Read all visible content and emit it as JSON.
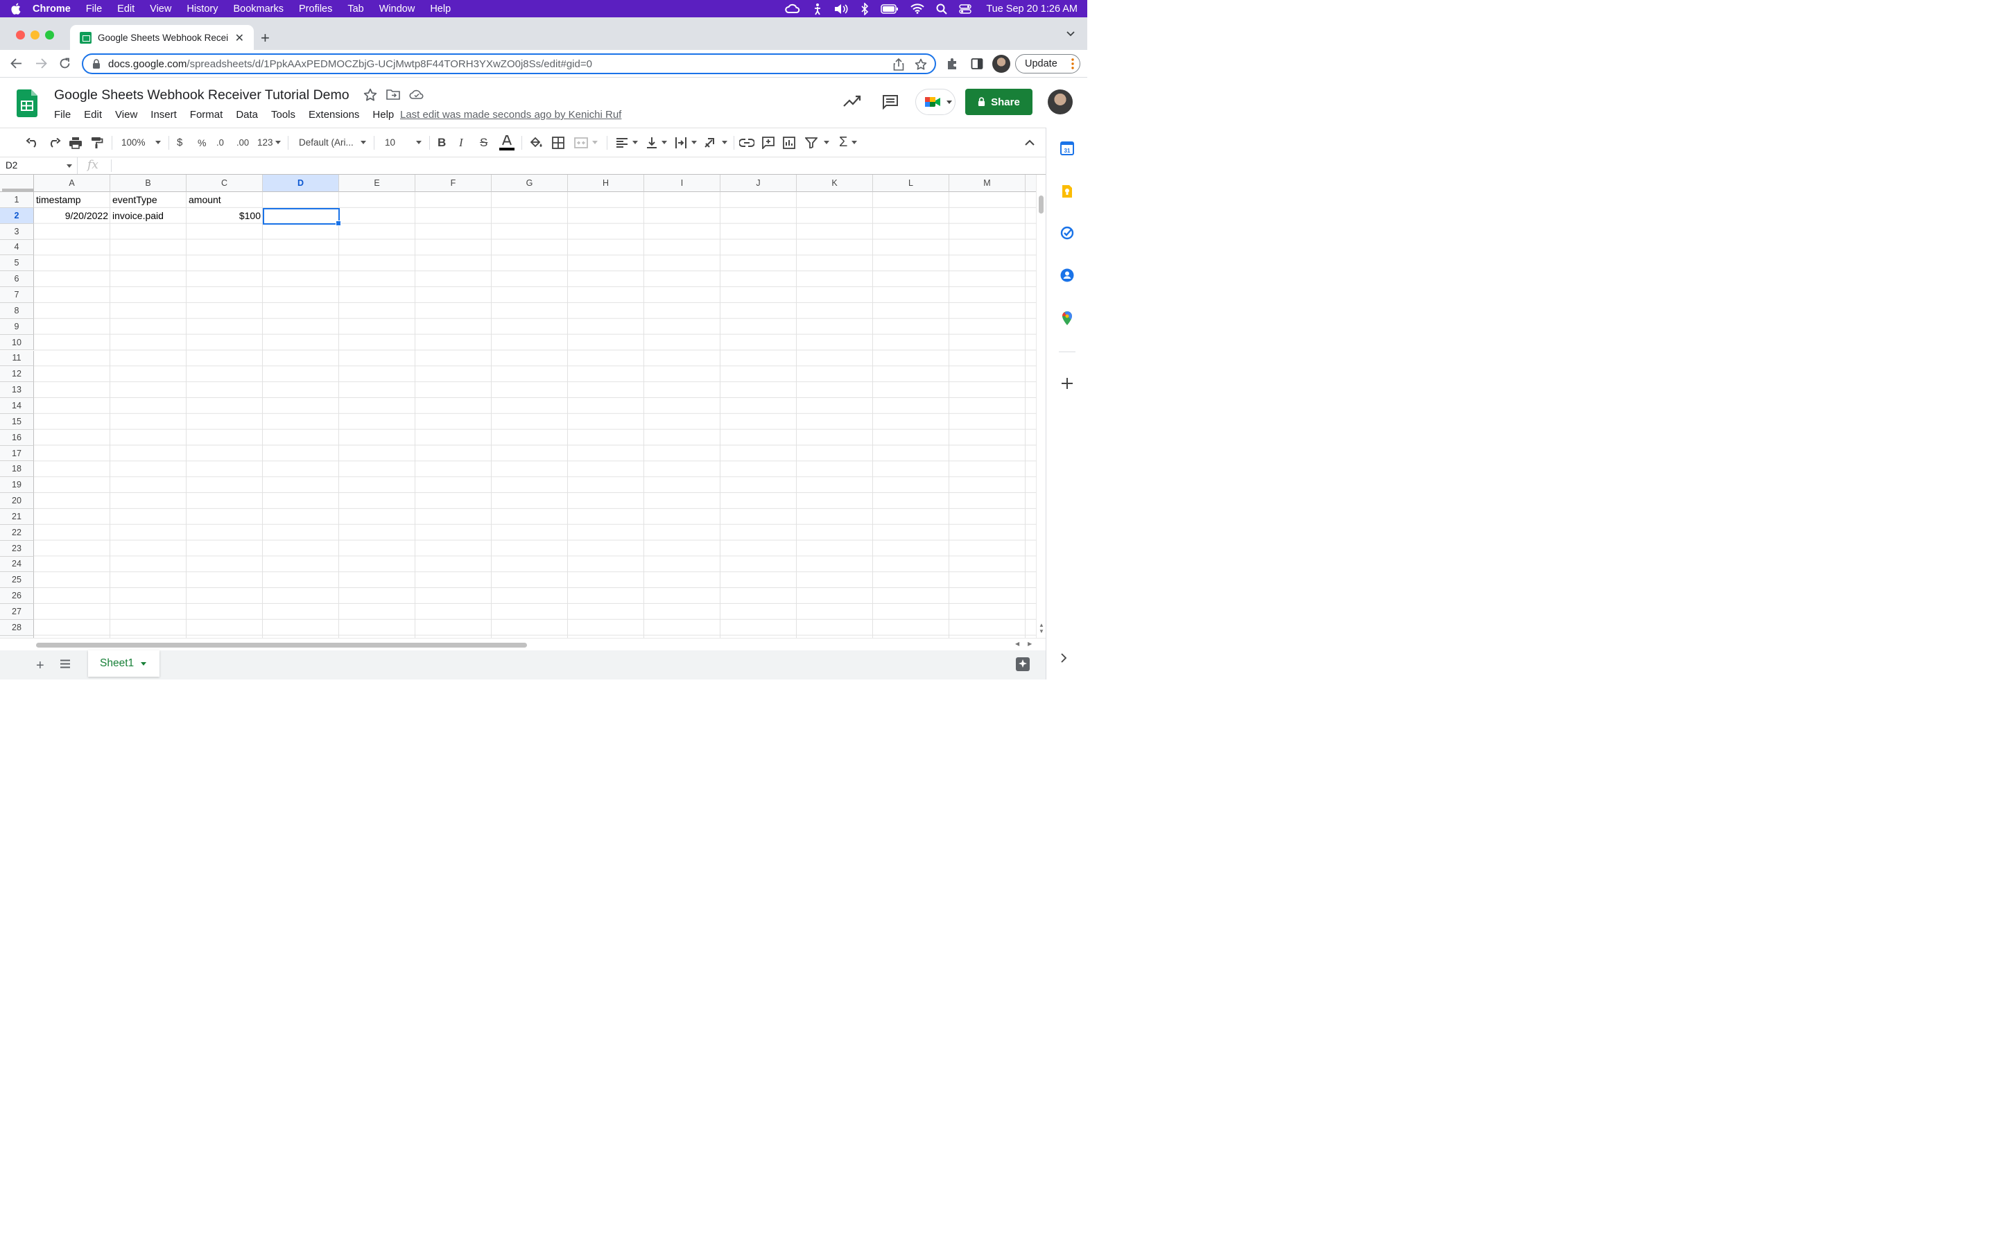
{
  "mac_menubar": {
    "app_name": "Chrome",
    "items": [
      "File",
      "Edit",
      "View",
      "History",
      "Bookmarks",
      "Profiles",
      "Tab",
      "Window",
      "Help"
    ],
    "clock": "Tue Sep 20  1:26 AM"
  },
  "browser": {
    "tab_title": "Google Sheets Webhook Recei",
    "url_host": "docs.google.com",
    "url_path": "/spreadsheets/d/1PpkAAxPEDMOCZbjG-UCjMwtp8F44TORH3YXwZO0j8Ss/edit#gid=0",
    "update_label": "Update"
  },
  "doc": {
    "title": "Google Sheets Webhook Receiver Tutorial Demo",
    "menu": [
      "File",
      "Edit",
      "View",
      "Insert",
      "Format",
      "Data",
      "Tools",
      "Extensions",
      "Help"
    ],
    "last_edit": "Last edit was made seconds ago by Kenichi Ruf",
    "share_label": "Share"
  },
  "toolbar": {
    "zoom": "100%",
    "currency": "$",
    "percent": "%",
    "dec_decrease": ".0",
    "dec_increase": ".00",
    "more_formats": "123",
    "font": "Default (Ari...",
    "font_size": "10"
  },
  "formula_bar": {
    "name_box": "D2",
    "fx": "fx"
  },
  "grid": {
    "columns": [
      "A",
      "B",
      "C",
      "D",
      "E",
      "F",
      "G",
      "H",
      "I",
      "J",
      "K",
      "L",
      "M"
    ],
    "row_count": 28,
    "selected_cell": "D2",
    "cells": {
      "A1": "timestamp",
      "B1": "eventType",
      "C1": "amount",
      "A2": "9/20/2022",
      "B2": "invoice.paid",
      "C2": "$100"
    }
  },
  "sheets": {
    "active": "Sheet1"
  },
  "colors": {
    "mac_bar": "#5b1fc0",
    "accent": "#1a73e8",
    "share_green": "#188038"
  }
}
